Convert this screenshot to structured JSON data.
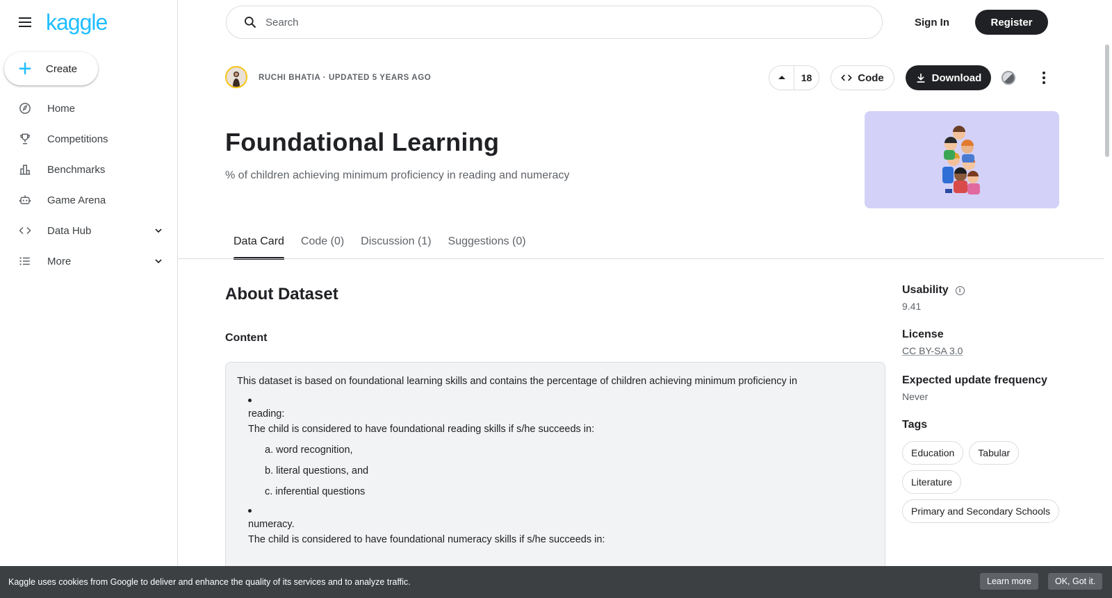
{
  "sidebar": {
    "logo": "kaggle",
    "create_label": "Create",
    "items": [
      {
        "label": "Home",
        "icon": "compass-icon"
      },
      {
        "label": "Competitions",
        "icon": "trophy-icon"
      },
      {
        "label": "Benchmarks",
        "icon": "bar-chart-icon"
      },
      {
        "label": "Game Arena",
        "icon": "robot-icon"
      },
      {
        "label": "Data Hub",
        "icon": "code-brackets-icon"
      },
      {
        "label": "More",
        "icon": "list-icon"
      }
    ]
  },
  "header": {
    "search_placeholder": "Search",
    "signin_label": "Sign In",
    "register_label": "Register"
  },
  "dataset": {
    "author_line": "RUCHI BHATIA · UPDATED 5 YEARS AGO",
    "upvotes": "18",
    "code_label": "Code",
    "download_label": "Download",
    "title": "Foundational Learning",
    "subtitle": "% of children achieving minimum proficiency in reading and numeracy"
  },
  "tabs": [
    {
      "label": "Data Card",
      "active": true
    },
    {
      "label": "Code (0)",
      "active": false
    },
    {
      "label": "Discussion (1)",
      "active": false
    },
    {
      "label": "Suggestions (0)",
      "active": false
    }
  ],
  "main": {
    "about_heading": "About Dataset",
    "content_heading": "Content",
    "intro": "This dataset is based on foundational learning skills and contains the percentage of children achieving minimum proficiency in",
    "reading_label": "reading:",
    "reading_desc": "The child is considered to have foundational reading skills if s/he succeeds in:",
    "reading_items": [
      "a. word recognition,",
      "b. literal questions, and",
      "c. inferential questions"
    ],
    "numeracy_label": "numeracy.",
    "numeracy_desc": "The child is considered to have foundational numeracy skills if s/he succeeds in:"
  },
  "side": {
    "usability_label": "Usability",
    "usability_value": "9.41",
    "license_label": "License",
    "license_value": "CC BY-SA 3.0",
    "frequency_label": "Expected update frequency",
    "frequency_value": "Never",
    "tags_label": "Tags",
    "tags": [
      "Education",
      "Tabular",
      "Literature",
      "Primary and Secondary Schools"
    ]
  },
  "cookie": {
    "text": "Kaggle uses cookies from Google to deliver and enhance the quality of its services and to analyze traffic.",
    "learn_more": "Learn more",
    "ok": "OK, Got it."
  },
  "colors": {
    "brand": "#20beff",
    "dark_button": "#202124",
    "cover_bg": "#d4d1f8",
    "cookie_bg": "#3c4043"
  }
}
